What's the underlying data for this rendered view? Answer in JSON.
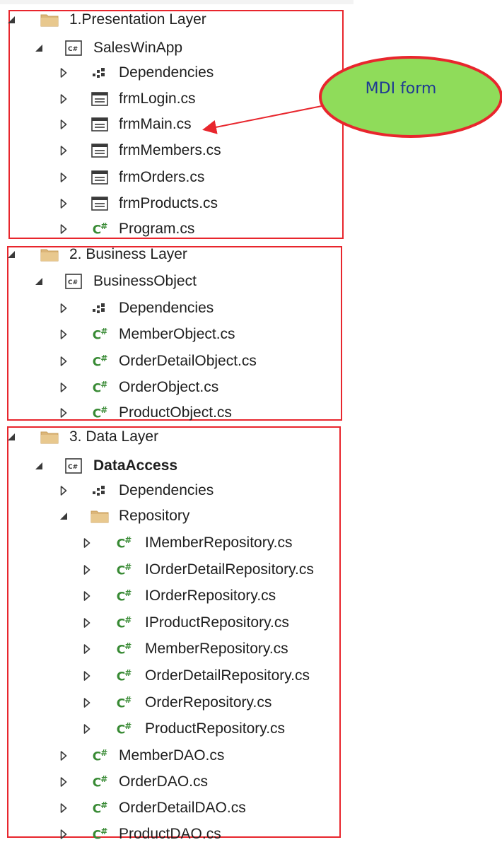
{
  "groups": [
    {
      "rows": [
        {
          "depth": 0,
          "exp": "expanded",
          "icon": "folder",
          "label": "1.Presentation Layer"
        },
        {
          "depth": 1,
          "exp": "expanded",
          "icon": "csproj",
          "label": "SalesWinApp"
        },
        {
          "depth": 2,
          "exp": "collapsed",
          "icon": "deps",
          "label": "Dependencies"
        },
        {
          "depth": 2,
          "exp": "collapsed",
          "icon": "form",
          "label": "frmLogin.cs"
        },
        {
          "depth": 2,
          "exp": "collapsed",
          "icon": "form",
          "label": "frmMain.cs"
        },
        {
          "depth": 2,
          "exp": "collapsed",
          "icon": "form",
          "label": "frmMembers.cs"
        },
        {
          "depth": 2,
          "exp": "collapsed",
          "icon": "form",
          "label": "frmOrders.cs"
        },
        {
          "depth": 2,
          "exp": "collapsed",
          "icon": "form",
          "label": "frmProducts.cs"
        },
        {
          "depth": 2,
          "exp": "collapsed",
          "icon": "cs",
          "label": "Program.cs"
        }
      ]
    },
    {
      "rows": [
        {
          "depth": 0,
          "exp": "expanded",
          "icon": "folder",
          "label": "2. Business Layer"
        },
        {
          "depth": 1,
          "exp": "expanded",
          "icon": "csproj",
          "label": "BusinessObject"
        },
        {
          "depth": 2,
          "exp": "collapsed",
          "icon": "deps",
          "label": "Dependencies"
        },
        {
          "depth": 2,
          "exp": "collapsed",
          "icon": "cs",
          "label": "MemberObject.cs"
        },
        {
          "depth": 2,
          "exp": "collapsed",
          "icon": "cs",
          "label": "OrderDetailObject.cs"
        },
        {
          "depth": 2,
          "exp": "collapsed",
          "icon": "cs",
          "label": "OrderObject.cs"
        },
        {
          "depth": 2,
          "exp": "collapsed",
          "icon": "cs",
          "label": "ProductObject.cs"
        }
      ]
    },
    {
      "rows": [
        {
          "depth": 0,
          "exp": "expanded",
          "icon": "folder",
          "label": "3. Data Layer"
        },
        {
          "depth": 1,
          "exp": "expanded",
          "icon": "csproj",
          "label": "DataAccess",
          "bold": true
        },
        {
          "depth": 2,
          "exp": "collapsed",
          "icon": "deps",
          "label": "Dependencies"
        },
        {
          "depth": 2,
          "exp": "expanded",
          "icon": "folder",
          "label": "Repository"
        },
        {
          "depth": 3,
          "exp": "collapsed",
          "icon": "cs",
          "label": "IMemberRepository.cs"
        },
        {
          "depth": 3,
          "exp": "collapsed",
          "icon": "cs",
          "label": "IOrderDetailRepository.cs"
        },
        {
          "depth": 3,
          "exp": "collapsed",
          "icon": "cs",
          "label": "IOrderRepository.cs"
        },
        {
          "depth": 3,
          "exp": "collapsed",
          "icon": "cs",
          "label": "IProductRepository.cs"
        },
        {
          "depth": 3,
          "exp": "collapsed",
          "icon": "cs",
          "label": "MemberRepository.cs"
        },
        {
          "depth": 3,
          "exp": "collapsed",
          "icon": "cs",
          "label": "OrderDetailRepository.cs"
        },
        {
          "depth": 3,
          "exp": "collapsed",
          "icon": "cs",
          "label": "OrderRepository.cs"
        },
        {
          "depth": 3,
          "exp": "collapsed",
          "icon": "cs",
          "label": "ProductRepository.cs"
        },
        {
          "depth": 2,
          "exp": "collapsed",
          "icon": "cs",
          "label": "MemberDAO.cs"
        },
        {
          "depth": 2,
          "exp": "collapsed",
          "icon": "cs",
          "label": "OrderDAO.cs"
        },
        {
          "depth": 2,
          "exp": "collapsed",
          "icon": "cs",
          "label": "OrderDetailDAO.cs"
        },
        {
          "depth": 2,
          "exp": "collapsed",
          "icon": "cs",
          "label": "ProductDAO.cs"
        }
      ]
    }
  ],
  "callout": {
    "text": "MDI form",
    "target": "frmMain.cs"
  },
  "colors": {
    "highlight_box": "#e8262d",
    "callout_fill": "#8fdc5a",
    "callout_border": "#e8262d",
    "callout_text": "#1f3a93",
    "cs_icon": "#388a34",
    "folder": "#dcb67a",
    "glyph": "#3a3a3a"
  }
}
